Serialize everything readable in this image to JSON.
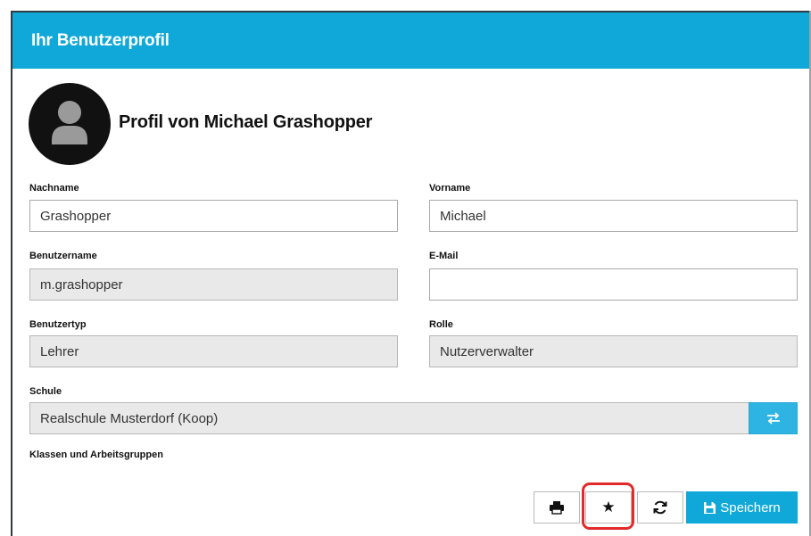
{
  "header": {
    "title": "Ihr Benutzerprofil"
  },
  "profile": {
    "heading": "Profil von Michael Grashopper"
  },
  "fields": {
    "nachname": {
      "label": "Nachname",
      "value": "Grashopper"
    },
    "vorname": {
      "label": "Vorname",
      "value": "Michael"
    },
    "benutzername": {
      "label": "Benutzername",
      "value": "m.grashopper"
    },
    "email": {
      "label": "E-Mail",
      "value": ""
    },
    "benutzertyp": {
      "label": "Benutzertyp",
      "value": "Lehrer"
    },
    "rolle": {
      "label": "Rolle",
      "value": "Nutzerverwalter"
    },
    "schule": {
      "label": "Schule",
      "value": "Realschule Musterdorf (Koop)"
    }
  },
  "klassen": {
    "label": "Klassen und Arbeitsgruppen"
  },
  "toolbar": {
    "print_icon": "print-icon",
    "favorite_icon": "star-icon",
    "refresh_icon": "refresh-icon",
    "save_label": "Speichern"
  },
  "colors": {
    "accent": "#0fa8d8",
    "highlight": "#e22a2a"
  }
}
